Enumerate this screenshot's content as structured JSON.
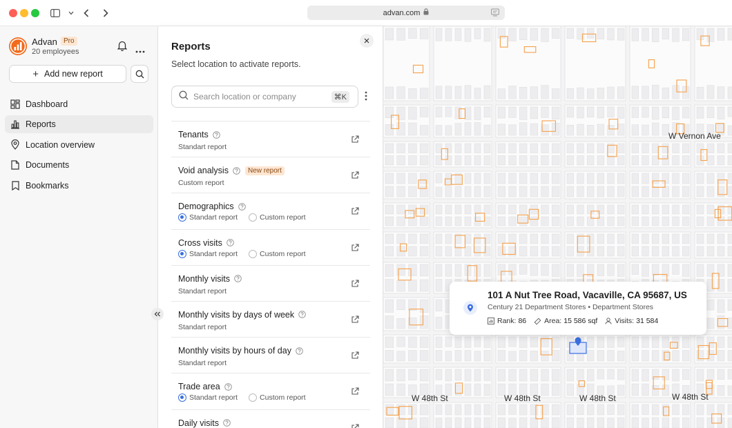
{
  "browser": {
    "url": "advan.com"
  },
  "sidebar": {
    "brand_name": "Advan",
    "plan_badge": "Pro",
    "employees": "20 employees",
    "add_report_label": "Add new report",
    "nav": [
      {
        "label": "Dashboard",
        "icon": "dashboard-icon",
        "active": false
      },
      {
        "label": "Reports",
        "icon": "bar-chart-icon",
        "active": true
      },
      {
        "label": "Location overview",
        "icon": "location-pin-icon",
        "active": false
      },
      {
        "label": "Documents",
        "icon": "document-icon",
        "active": false
      },
      {
        "label": "Bookmarks",
        "icon": "bookmark-icon",
        "active": false
      }
    ]
  },
  "reports_panel": {
    "title": "Reports",
    "subtitle": "Select location to activate reports.",
    "search_placeholder": "Search location or company",
    "search_shortcut": "⌘K",
    "items": [
      {
        "name": "Tenants",
        "subtitle": "Standart report"
      },
      {
        "name": "Void analysis",
        "badge": "New report",
        "subtitle": "Custom report"
      },
      {
        "name": "Demographics",
        "options": [
          "Standart report",
          "Custom report"
        ],
        "selected": 0
      },
      {
        "name": "Cross visits",
        "options": [
          "Standart report",
          "Custom report"
        ],
        "selected": 0
      },
      {
        "name": "Monthly visits",
        "subtitle": "Standart report"
      },
      {
        "name": "Monthly visits by days of week",
        "subtitle": "Standart report"
      },
      {
        "name": "Monthly visits by hours of day",
        "subtitle": "Standart report"
      },
      {
        "name": "Trade area",
        "options": [
          "Standart report",
          "Custom report"
        ],
        "selected": 0
      },
      {
        "name": "Daily visits",
        "subtitle": ""
      }
    ]
  },
  "map": {
    "streets": {
      "vernon": "W Vernon Ave",
      "s48_a": "W 48th St",
      "s48_b": "W 48th St",
      "s48_c": "W 48th St",
      "s48_d": "W 48th St"
    },
    "popup": {
      "address": "101 A Nut Tree Road, Vacaville, CA 95687, US",
      "company": "Century 21 Department Stores",
      "category": "Department Stores",
      "separator": "•",
      "rank_label": "Rank:",
      "rank_value": "86",
      "area_label": "Area:",
      "area_value": "15 586 sqf",
      "visits_label": "Visits:",
      "visits_value": "31 584"
    },
    "accent_color": "#f5a04a",
    "selected_color": "#3b6fe0"
  }
}
